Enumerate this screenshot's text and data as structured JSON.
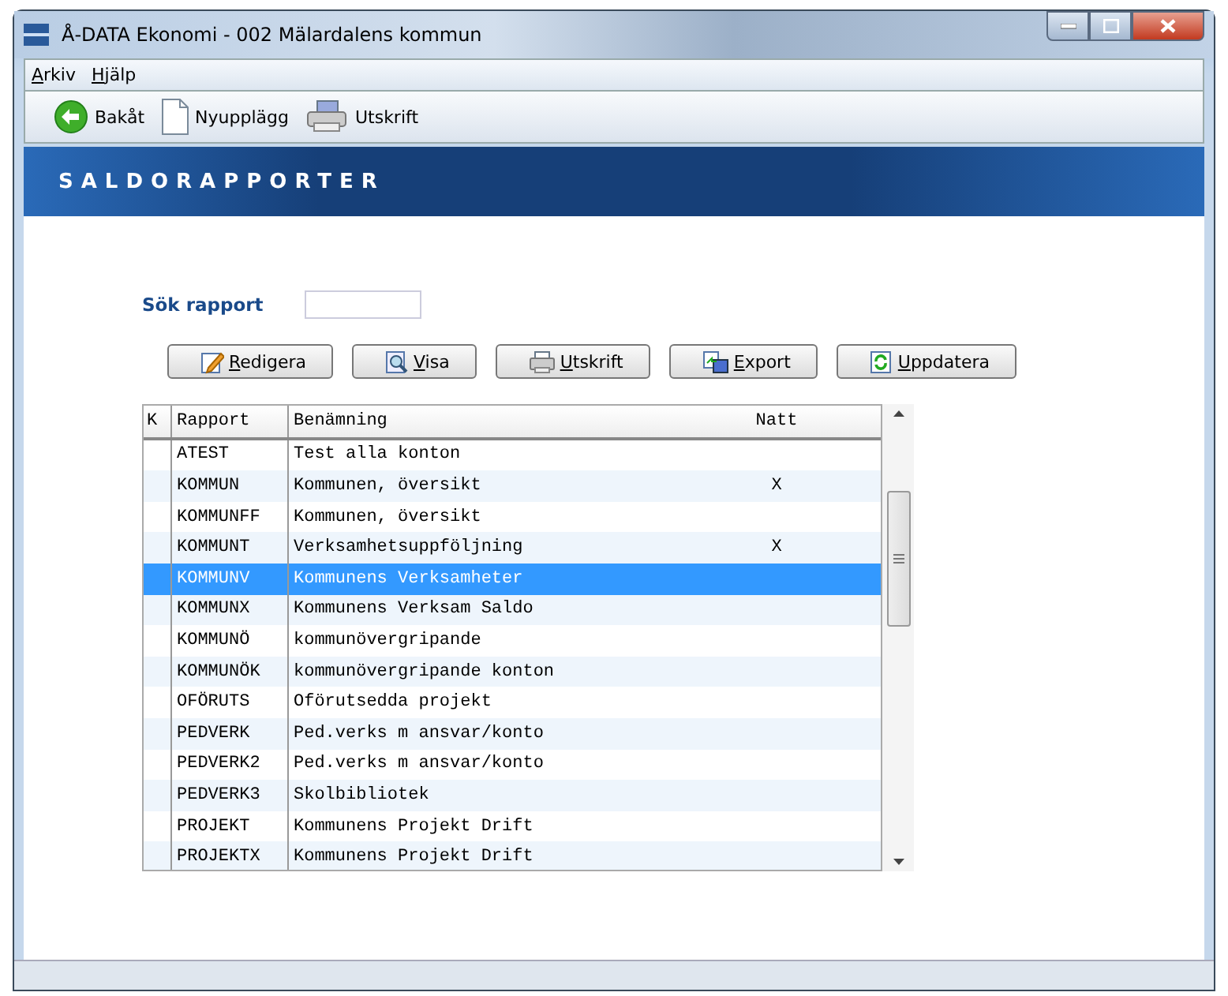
{
  "window": {
    "title": "Å-DATA Ekonomi  -  002 Mälardalens kommun"
  },
  "menu": [
    "Arkiv",
    "Hjälp"
  ],
  "toolbar": [
    {
      "kind": "back",
      "label": "Bakåt"
    },
    {
      "kind": "new",
      "label": "Nyupplägg"
    },
    {
      "kind": "print",
      "label": "Utskrift"
    }
  ],
  "banner": "SALDORAPPORTER",
  "search": {
    "label": "Sök rapport"
  },
  "buttons": [
    {
      "kind": "edit",
      "label": "Redigera"
    },
    {
      "kind": "view",
      "label": "Visa"
    },
    {
      "kind": "print",
      "label": "Utskrift"
    },
    {
      "kind": "export",
      "label": "Export"
    },
    {
      "kind": "refresh",
      "label": "Uppdatera"
    }
  ],
  "table": {
    "columns": [
      "K",
      "Rapport",
      "Benämning",
      "Natt"
    ],
    "rows": [
      {
        "rapport": "ATEST",
        "benamning": "Test alla konton",
        "natt": "",
        "selected": false
      },
      {
        "rapport": "KOMMUN",
        "benamning": "Kommunen, översikt",
        "natt": "X",
        "selected": false
      },
      {
        "rapport": "KOMMUNFF",
        "benamning": "Kommunen, översikt",
        "natt": "",
        "selected": false
      },
      {
        "rapport": "KOMMUNT",
        "benamning": "Verksamhetsuppföljning",
        "natt": "X",
        "selected": false
      },
      {
        "rapport": "KOMMUNV",
        "benamning": "Kommunens Verksamheter",
        "natt": "",
        "selected": true
      },
      {
        "rapport": "KOMMUNX",
        "benamning": "Kommunens Verksam Saldo",
        "natt": "",
        "selected": false
      },
      {
        "rapport": "KOMMUNÖ",
        "benamning": "kommunövergripande",
        "natt": "",
        "selected": false
      },
      {
        "rapport": "KOMMUNÖK",
        "benamning": "kommunövergripande konton",
        "natt": "",
        "selected": false
      },
      {
        "rapport": "OFÖRUTS",
        "benamning": "Oförutsedda projekt",
        "natt": "",
        "selected": false
      },
      {
        "rapport": "PEDVERK",
        "benamning": "Ped.verks m ansvar/konto",
        "natt": "",
        "selected": false
      },
      {
        "rapport": "PEDVERK2",
        "benamning": "Ped.verks m ansvar/konto",
        "natt": "",
        "selected": false
      },
      {
        "rapport": "PEDVERK3",
        "benamning": "Skolbibliotek",
        "natt": "",
        "selected": false
      },
      {
        "rapport": "PROJEKT",
        "benamning": "Kommunens Projekt Drift",
        "natt": "",
        "selected": false
      },
      {
        "rapport": "PROJEKTX",
        "benamning": "Kommunens Projekt Drift",
        "natt": "",
        "selected": false
      }
    ]
  }
}
